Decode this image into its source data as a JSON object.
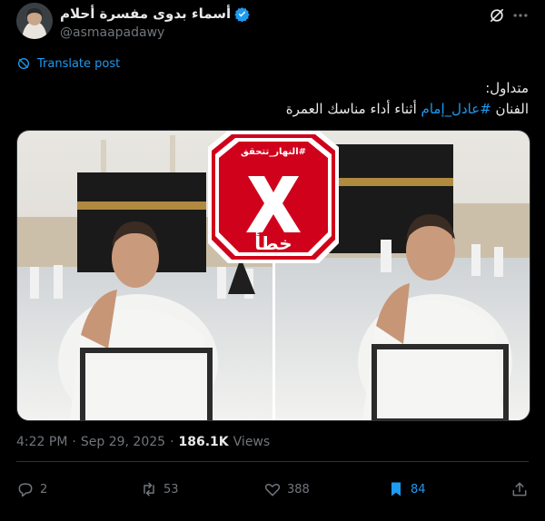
{
  "author": {
    "name": "أسماء بدوى مفسرة أحلام",
    "handle": "@asmaapadawy",
    "verified": true
  },
  "translate_label": "Translate post",
  "tweet": {
    "line1": "متداول:",
    "line2_prefix": "الفنان ",
    "hashtag": "#عادل_إمام",
    "line2_suffix": " أثناء أداء مناسك العمرة"
  },
  "media": {
    "stamp_tag": "#النهار_تتحقق",
    "stamp_verdict": "خطأ",
    "stamp_color": "#d0021b"
  },
  "meta": {
    "time": "4:22 PM",
    "dot1": "·",
    "date": "Sep 29, 2025",
    "dot2": "·",
    "views_count": "186.1K",
    "views_label": "Views"
  },
  "actions": {
    "replies": "2",
    "reposts": "53",
    "likes": "388",
    "bookmarks": "84"
  },
  "colors": {
    "accent": "#1d9bf0",
    "muted": "#71767b",
    "text": "#e7e9ea",
    "background": "#000000"
  }
}
